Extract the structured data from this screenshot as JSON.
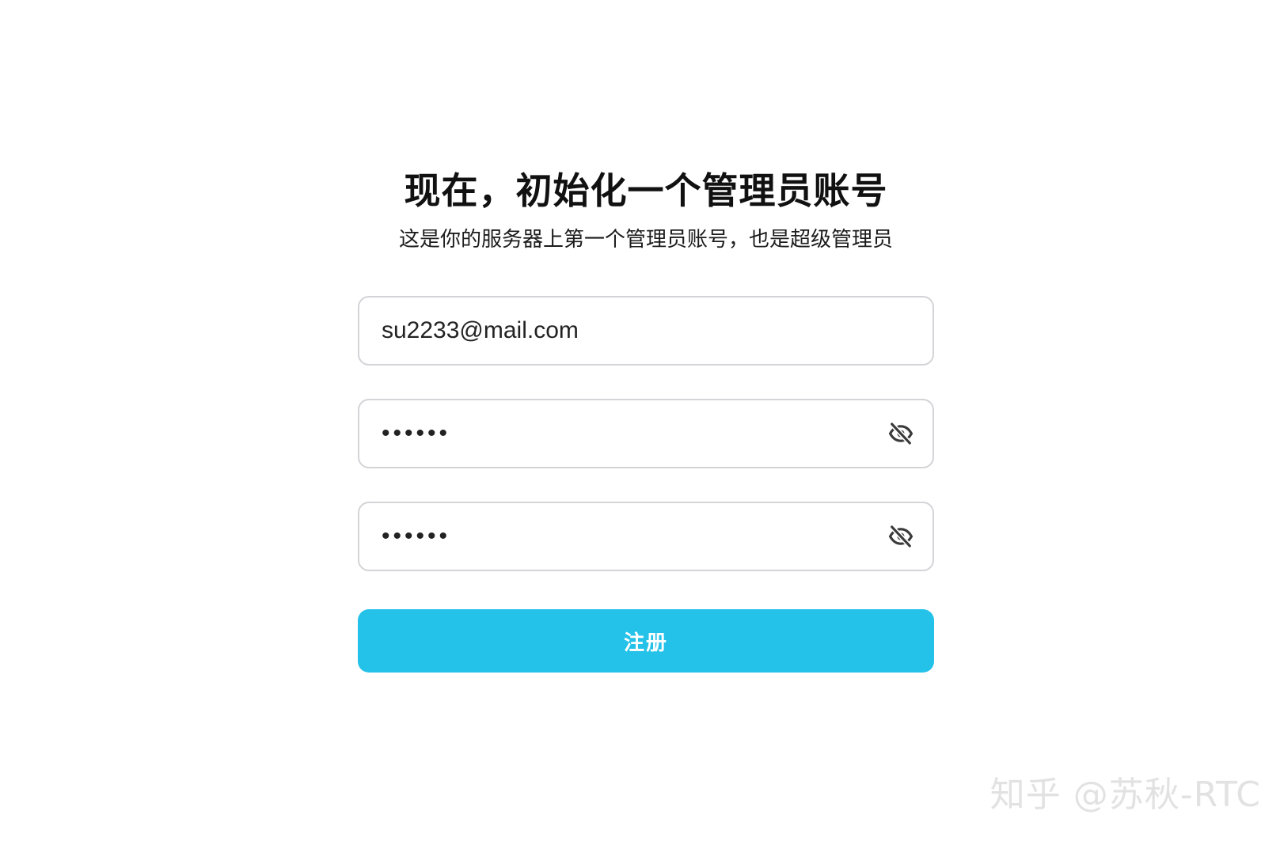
{
  "header": {
    "title": "现在，初始化一个管理员账号",
    "subtitle": "这是你的服务器上第一个管理员账号，也是超级管理员"
  },
  "form": {
    "email_value": "su2233@mail.com",
    "password_value": "123456",
    "confirm_password_value": "123456",
    "password_toggle_icon": "eye-off-icon",
    "submit_label": "注册"
  },
  "colors": {
    "accent": "#24c2e8",
    "field_border": "#d4d4d8",
    "title_text": "#111111"
  },
  "watermark": {
    "text": "知乎 @苏秋-RTC"
  }
}
